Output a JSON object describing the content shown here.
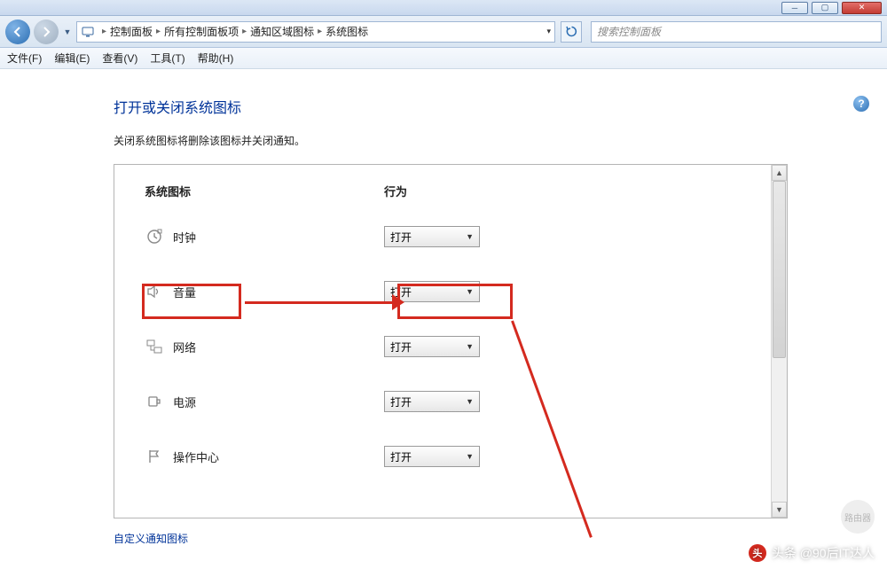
{
  "titlebar": {
    "min": "─",
    "max": "▢",
    "close": "✕"
  },
  "nav": {
    "breadcrumb": [
      "控制面板",
      "所有控制面板项",
      "通知区域图标",
      "系统图标"
    ],
    "search_placeholder": "搜索控制面板"
  },
  "menu": {
    "file": "文件(F)",
    "edit": "编辑(E)",
    "view": "查看(V)",
    "tools": "工具(T)",
    "help": "帮助(H)"
  },
  "page": {
    "heading": "打开或关闭系统图标",
    "subtext": "关闭系统图标将删除该图标并关闭通知。",
    "col_icon": "系统图标",
    "col_behavior": "行为",
    "link": "自定义通知图标"
  },
  "rows": [
    {
      "label": "时钟",
      "value": "打开"
    },
    {
      "label": "音量",
      "value": "打开"
    },
    {
      "label": "网络",
      "value": "打开"
    },
    {
      "label": "电源",
      "value": "打开"
    },
    {
      "label": "操作中心",
      "value": "打开"
    }
  ],
  "watermark": "头条 @90后IT达人",
  "wm_badge": "路由器"
}
